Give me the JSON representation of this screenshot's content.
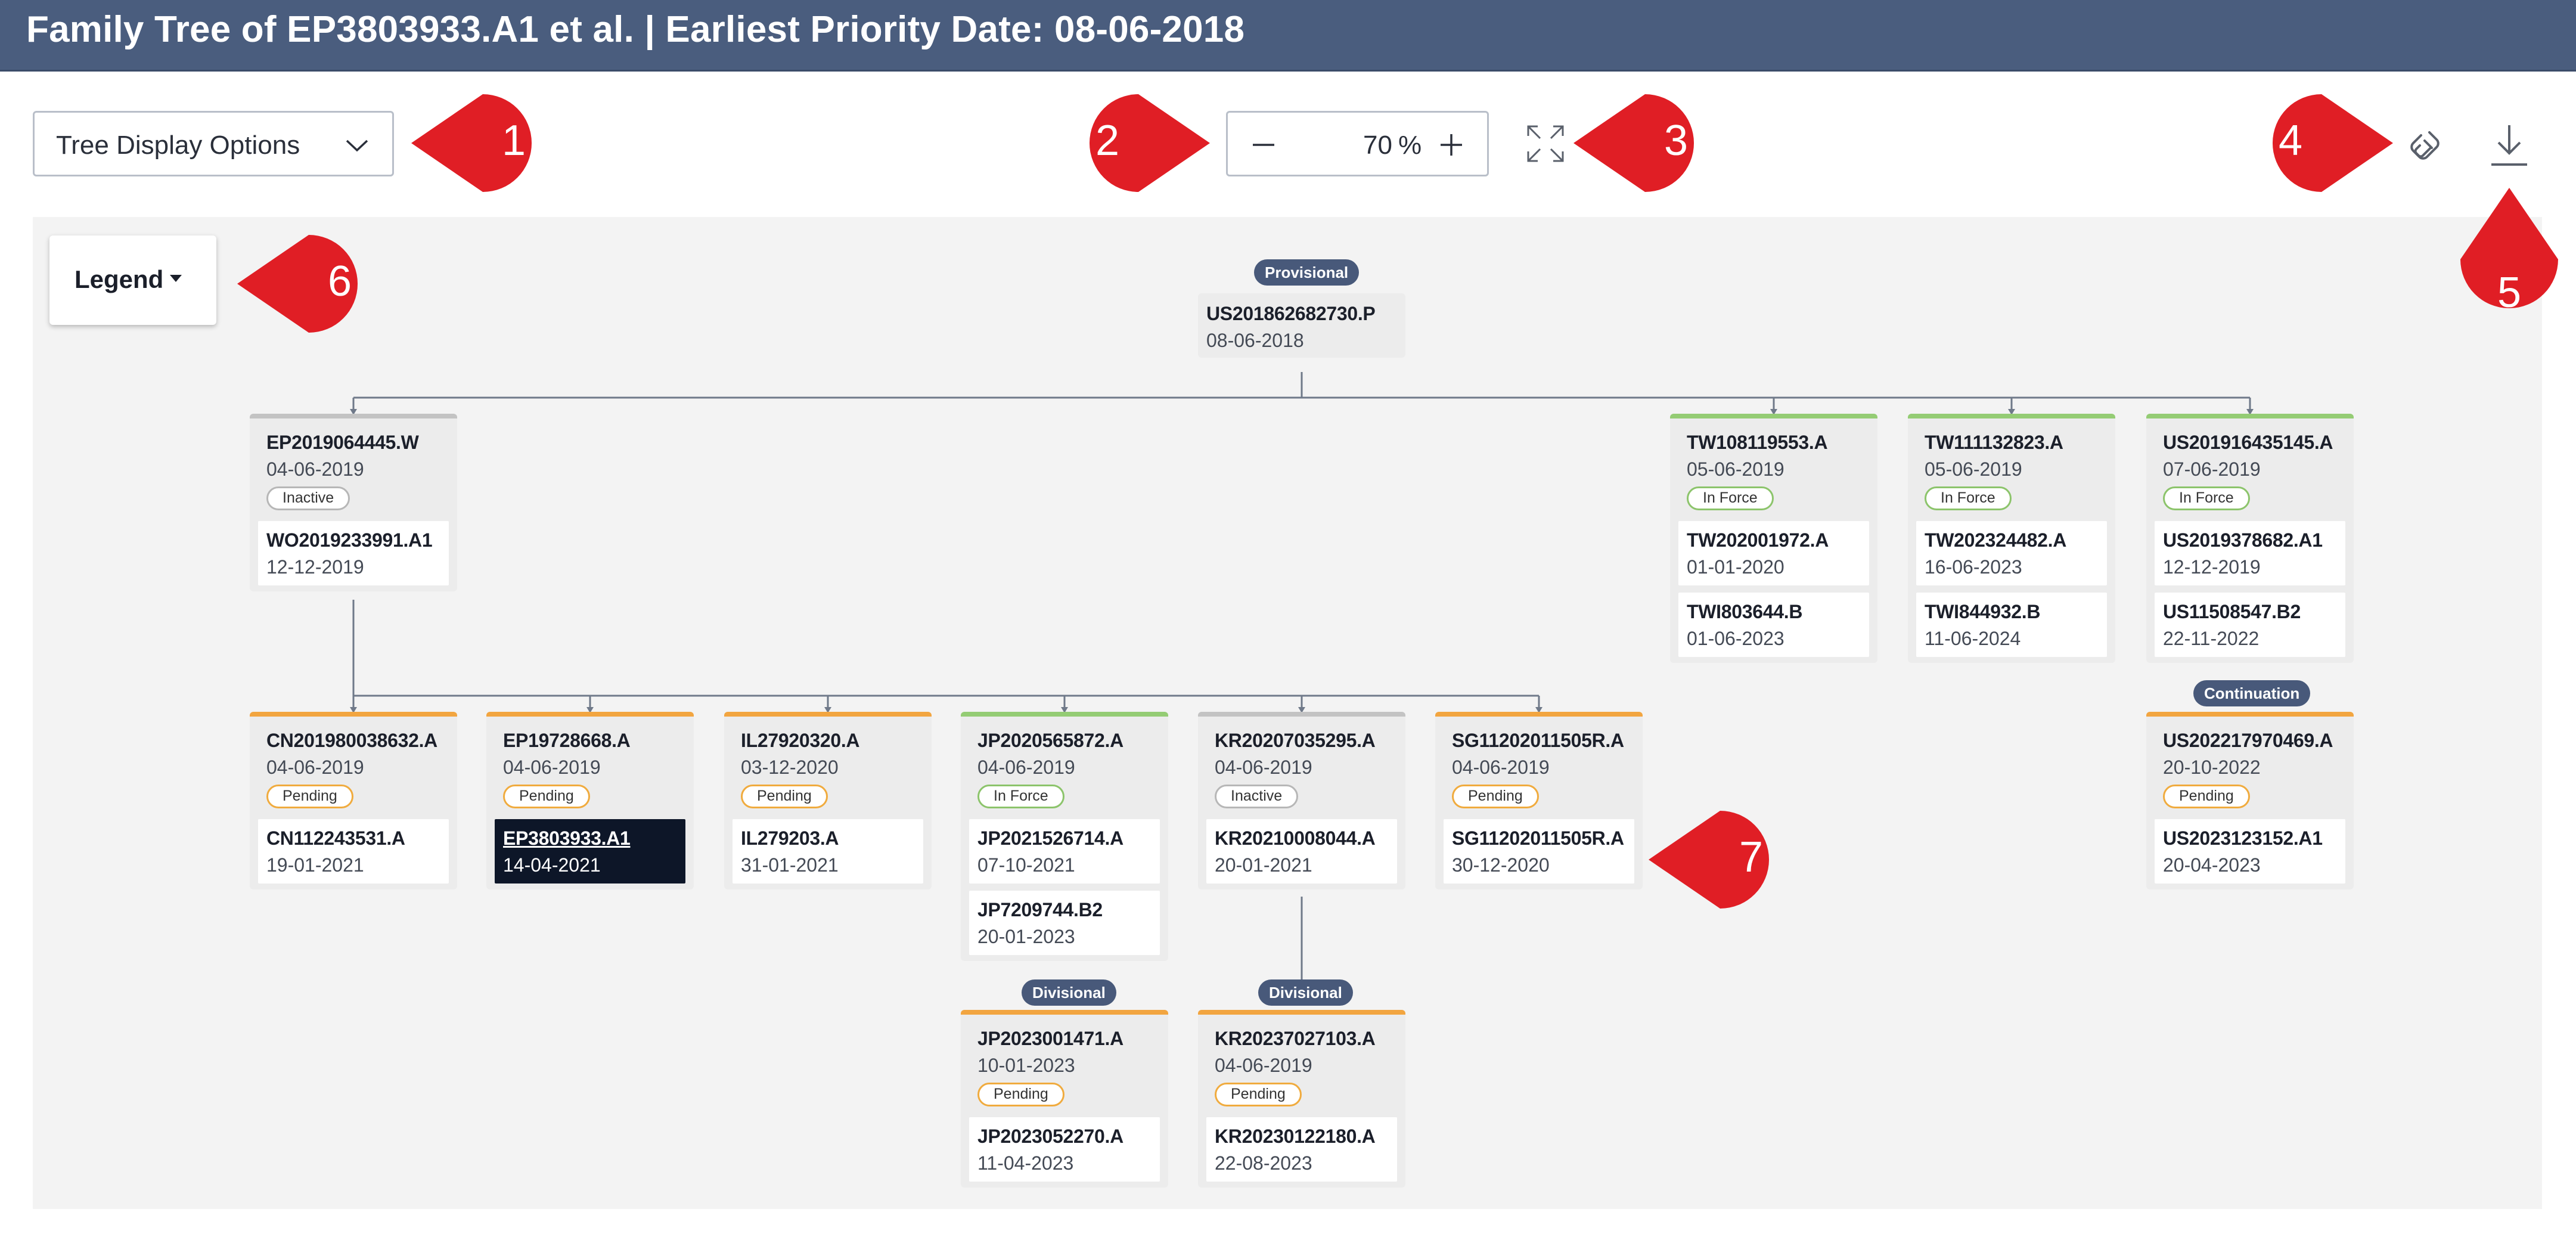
{
  "header": {
    "title": "Family Tree of EP3803933.A1 et al. | Earliest Priority Date: 08-06-2018"
  },
  "toolbar": {
    "tree_options_label": "Tree Display Options",
    "zoom_value": "70",
    "zoom_unit": "%"
  },
  "legend": {
    "label": "Legend"
  },
  "markers": [
    "1",
    "2",
    "3",
    "4",
    "5",
    "6",
    "7"
  ],
  "colors": {
    "header_bg": "#4a5d7e",
    "marker_red": "#e01e25",
    "pending": "#f0ab3e",
    "in_force": "#8cc46b",
    "inactive": "#b7b7b7",
    "tag_bg": "#48597a",
    "selected_bg": "#0d1628"
  },
  "icons": {
    "tree_options": "chevron-down-icon",
    "zoom_out": "minus-icon",
    "zoom_in": "plus-icon",
    "fit": "expand-icon",
    "link": "paperclip-link-icon",
    "download": "download-icon",
    "legend": "caret-down-icon"
  },
  "tags": {
    "provisional": "Provisional",
    "continuation": "Continuation",
    "divisional_jp": "Divisional",
    "divisional_kr": "Divisional"
  },
  "nodes": {
    "root": {
      "number": "US201862682730.P",
      "date": "08-06-2018"
    },
    "ep_w": {
      "number": "EP2019064445.W",
      "date": "04-06-2019",
      "status": "Inactive",
      "members": [
        {
          "number": "WO2019233991.A1",
          "date": "12-12-2019"
        }
      ]
    },
    "tw1": {
      "number": "TW108119553.A",
      "date": "05-06-2019",
      "status": "In Force",
      "members": [
        {
          "number": "TW202001972.A",
          "date": "01-01-2020"
        },
        {
          "number": "TWI803644.B",
          "date": "01-06-2023"
        }
      ]
    },
    "tw2": {
      "number": "TW111132823.A",
      "date": "05-06-2019",
      "status": "In Force",
      "members": [
        {
          "number": "TW202324482.A",
          "date": "16-06-2023"
        },
        {
          "number": "TWI844932.B",
          "date": "11-06-2024"
        }
      ]
    },
    "us1": {
      "number": "US201916435145.A",
      "date": "07-06-2019",
      "status": "In Force",
      "members": [
        {
          "number": "US2019378682.A1",
          "date": "12-12-2019"
        },
        {
          "number": "US11508547.B2",
          "date": "22-11-2022"
        }
      ]
    },
    "cn": {
      "number": "CN201980038632.A",
      "date": "04-06-2019",
      "status": "Pending",
      "members": [
        {
          "number": "CN112243531.A",
          "date": "19-01-2021"
        }
      ]
    },
    "ep": {
      "number": "EP19728668.A",
      "date": "04-06-2019",
      "status": "Pending",
      "members": [
        {
          "number": "EP3803933.A1",
          "date": "14-04-2021"
        }
      ]
    },
    "il": {
      "number": "IL27920320.A",
      "date": "03-12-2020",
      "status": "Pending",
      "members": [
        {
          "number": "IL279203.A",
          "date": "31-01-2021"
        }
      ]
    },
    "jp": {
      "number": "JP2020565872.A",
      "date": "04-06-2019",
      "status": "In Force",
      "members": [
        {
          "number": "JP2021526714.A",
          "date": "07-10-2021"
        },
        {
          "number": "JP7209744.B2",
          "date": "20-01-2023"
        }
      ]
    },
    "kr": {
      "number": "KR20207035295.A",
      "date": "04-06-2019",
      "status": "Inactive",
      "members": [
        {
          "number": "KR20210008044.A",
          "date": "20-01-2021"
        }
      ]
    },
    "sg": {
      "number": "SG11202011505R.A",
      "date": "04-06-2019",
      "status": "Pending",
      "members": [
        {
          "number": "SG11202011505R.A",
          "date": "30-12-2020"
        }
      ]
    },
    "us2": {
      "number": "US202217970469.A",
      "date": "20-10-2022",
      "status": "Pending",
      "members": [
        {
          "number": "US2023123152.A1",
          "date": "20-04-2023"
        }
      ]
    },
    "jp2": {
      "number": "JP2023001471.A",
      "date": "10-01-2023",
      "status": "Pending",
      "members": [
        {
          "number": "JP2023052270.A",
          "date": "11-04-2023"
        }
      ]
    },
    "kr2": {
      "number": "KR20237027103.A",
      "date": "04-06-2019",
      "status": "Pending",
      "members": [
        {
          "number": "KR20230122180.A",
          "date": "22-08-2023"
        }
      ]
    }
  }
}
